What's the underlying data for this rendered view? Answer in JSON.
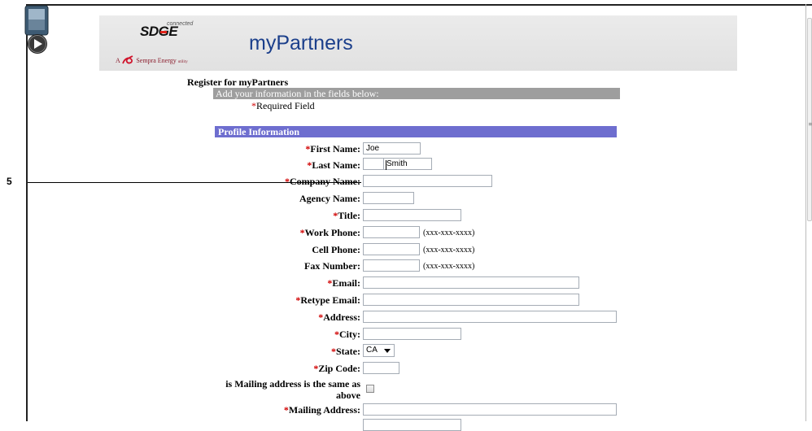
{
  "header": {
    "brand_logo": "SDGE",
    "brand_tagline": "connected",
    "parent_prefix": "A",
    "parent_company": "Sempra Energy",
    "parent_suffix": "utility",
    "app_title": "myPartners"
  },
  "page": {
    "title": "Register for myPartners",
    "instruction": "Add your information in the fields below:",
    "required_mark": "*",
    "required_note": "Required Field",
    "section_title": "Profile Information"
  },
  "form": {
    "first_name": {
      "label": "First Name:",
      "value": "Joe"
    },
    "last_name": {
      "label": "Last Name:",
      "value": "Smith"
    },
    "company_name": {
      "label": "Company Name:",
      "value": ""
    },
    "agency_name": {
      "label": "Agency Name:",
      "value": ""
    },
    "title": {
      "label": "Title:",
      "value": ""
    },
    "work_phone": {
      "label": "Work Phone:",
      "value": "",
      "format": "(xxx-xxx-xxxx)"
    },
    "cell_phone": {
      "label": "Cell Phone:",
      "value": "",
      "format": "(xxx-xxx-xxxx)"
    },
    "fax_number": {
      "label": "Fax Number:",
      "value": "",
      "format": "(xxx-xxx-xxxx)"
    },
    "email": {
      "label": "Email:",
      "value": ""
    },
    "retype_email": {
      "label": "Retype Email:",
      "value": ""
    },
    "address": {
      "label": "Address:",
      "value": ""
    },
    "city": {
      "label": "City:",
      "value": ""
    },
    "state": {
      "label": "State:",
      "value": "CA"
    },
    "zip_code": {
      "label": "Zip Code:",
      "value": ""
    },
    "mailing_same": {
      "label_line1": "is Mailing address is the same as",
      "label_line2": "above",
      "checked": false
    },
    "mailing_address": {
      "label": "Mailing Address:",
      "value": ""
    }
  },
  "callout": {
    "number": "5"
  },
  "colors": {
    "required": "#d10000",
    "section_bar": "#6e6ecf",
    "instruction_bar": "#9e9e9e",
    "app_title": "#1b3f8b"
  },
  "icons": {
    "video": "video-play-icon",
    "sempra": "sempra-swirl-icon"
  }
}
